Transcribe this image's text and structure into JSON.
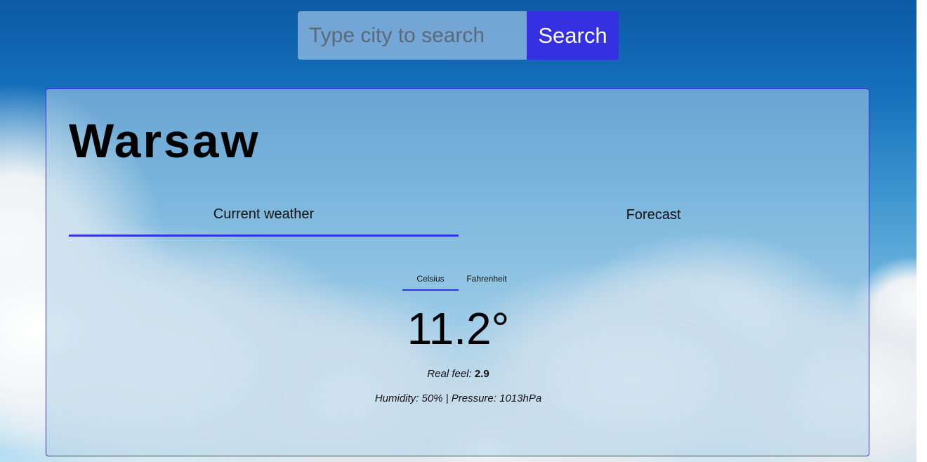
{
  "search": {
    "placeholder": "Type city to search",
    "value": "",
    "button_label": "Search"
  },
  "weather": {
    "city": "Warsaw",
    "tabs": [
      {
        "label": "Current weather",
        "active": true
      },
      {
        "label": "Forecast",
        "active": false
      }
    ],
    "units": [
      {
        "label": "Celsius",
        "active": true
      },
      {
        "label": "Fahrenheit",
        "active": false
      }
    ],
    "temperature": "11.2°",
    "real_feel_label": "Real feel:",
    "real_feel_value": "2.9",
    "details": "Humidity: 50% | Pressure: 1013hPa"
  },
  "colors": {
    "accent": "#3530e0"
  }
}
